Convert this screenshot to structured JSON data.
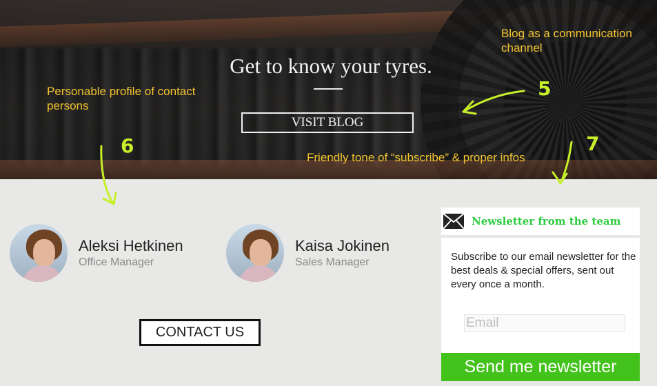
{
  "hero": {
    "title": "Get to know your tyres.",
    "visit_blog_label": "VISIT BLOG"
  },
  "annotations": {
    "blog": "Blog as a communication channel",
    "blog_number": "5",
    "profile": "Personable profile of contact persons",
    "profile_number": "6",
    "tone": "Friendly tone of “subscribe” & proper infos",
    "tone_number": "7",
    "annotation_text_color": "#f4c430",
    "arrow_color": "#c7f02a"
  },
  "contacts": [
    {
      "name": "Aleksi Hetkinen",
      "role": "Office Manager"
    },
    {
      "name": "Kaisa Jokinen",
      "role": "Sales Manager"
    }
  ],
  "contact_button_label": "CONTACT US",
  "newsletter": {
    "icon": "envelope-icon",
    "title": "Newsletter from the team",
    "description": "Subscribe to our email newsletter for the best deals & special offers, sent out every once a month.",
    "email_placeholder": "Email",
    "email_value": "",
    "send_label": "Send me newsletter",
    "accent_color": "#43c21c"
  }
}
